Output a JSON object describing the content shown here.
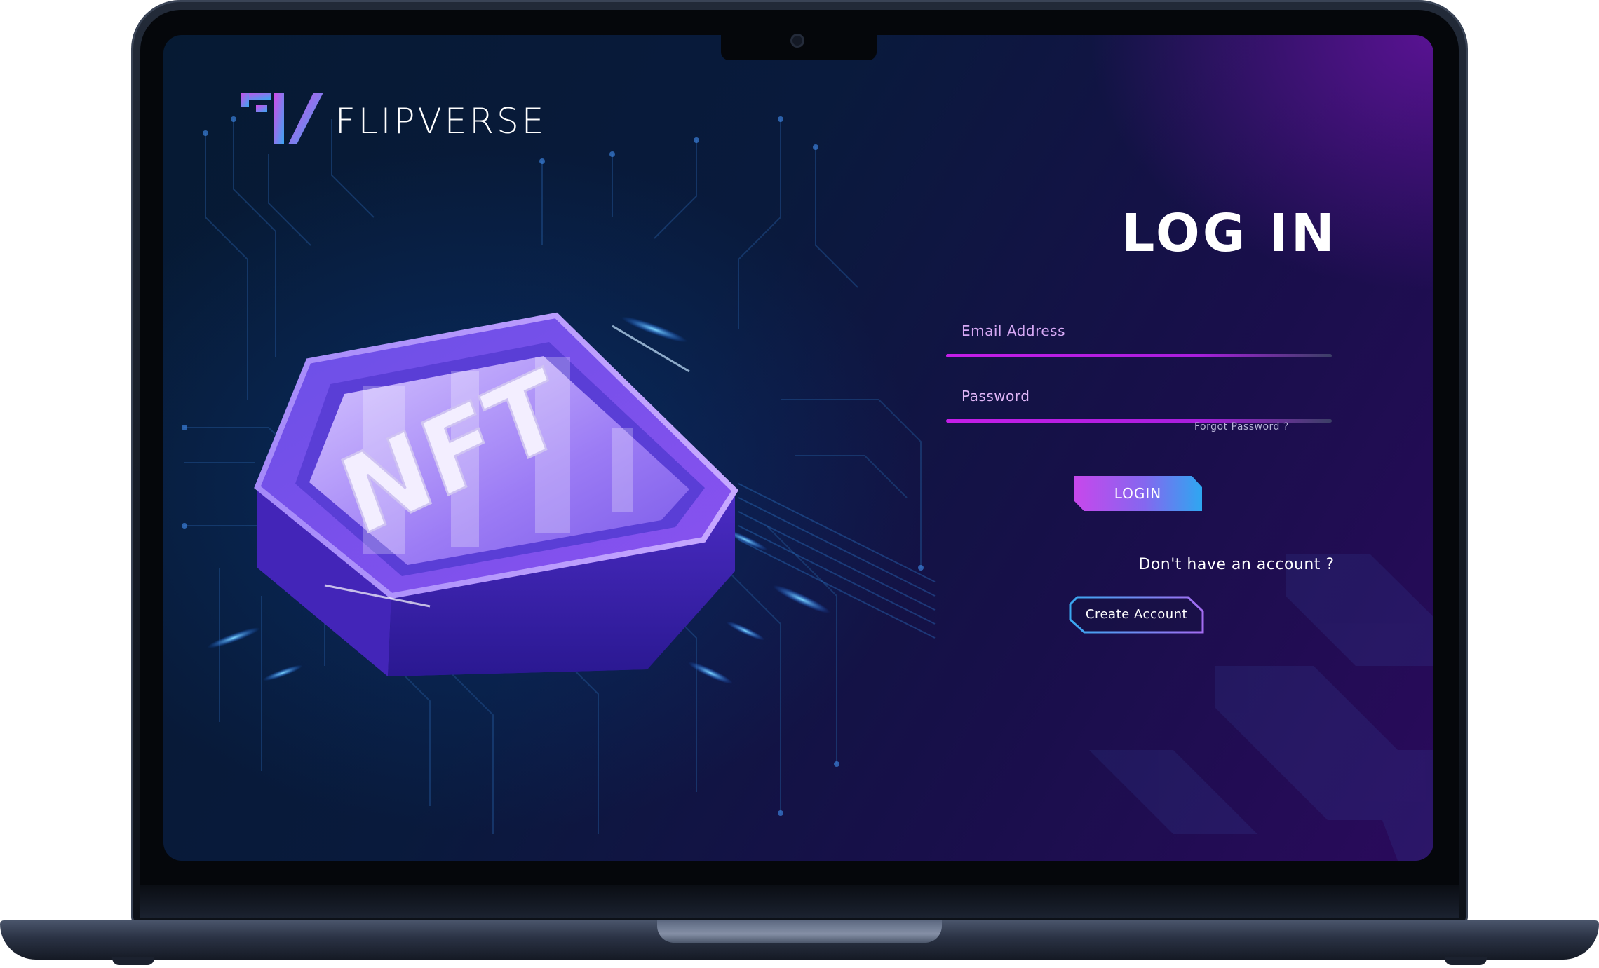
{
  "brand": {
    "name": "FLIPVERSE",
    "logo_icon": "fv-logo-icon"
  },
  "hero": {
    "badge_text": "NFT"
  },
  "login": {
    "title": "LOG IN",
    "email_label": "Email Address",
    "password_label": "Password",
    "forgot_password": "Forgot Password ?",
    "login_button": "LOGIN",
    "no_account_text": "Don't have an account ?",
    "create_account_button": "Create Account"
  },
  "colors": {
    "accent_purple": "#c41ee8",
    "accent_blue": "#2ea7f1",
    "background_dark": "#061a33",
    "text_primary": "#ffffff"
  }
}
